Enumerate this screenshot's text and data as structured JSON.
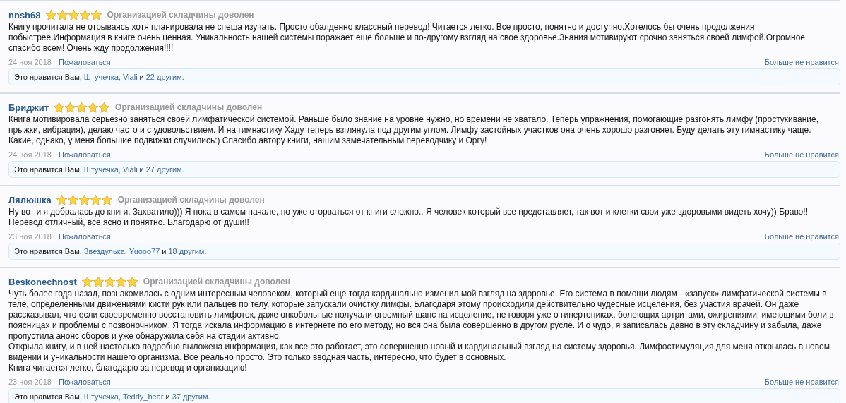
{
  "reviews": [
    {
      "author": "nnsh68",
      "stars": 5,
      "rating_text": "Организацией складчины доволен",
      "lines": [
        "Книгу прочитала не отрываясь хотя планировала не спеша изучать. Просто обалденно классный перевод! Читается легко. Все просто, понятно и доступно.Хотелось бы очень продолжения",
        "побыстрее.Информация в книге очень ценная. Уникальность нашей системы поражает еще больше и по-другому взгляд на свое здоровье.Знания мотивируют срочно заняться своей лимфой.Огромное",
        "спасибо всем! Очень жду продолжения!!!!"
      ],
      "date": "24 ноя 2018",
      "report_link": "Пожаловаться",
      "unlike_link": "Больше не нравится",
      "likes": {
        "prefix": "Это нравится Вам,",
        "users": [
          "Штучечка,",
          "Viali"
        ],
        "joiner": "и",
        "others": "22 другим."
      }
    },
    {
      "author": "Бриджит",
      "stars": 5,
      "rating_text": "Организацией складчины доволен",
      "lines": [
        "Книга мотивировала серьезно заняться своей лимфатической системой. Раньше было знание на уровне нужно, но времени не хватало. Теперь упражнения, помогающие разгонять лимфу (простукивание,",
        "прыжки, вибрация), делаю часто и с удовольствием. И на гимнастику Хаду теперь взглянула под другим углом. Лимфу застойных участков она очень хорошо разгоняет. Буду делать эту гимнастику чаще.",
        "Какие, однако, у меня большие подвижки случились:) Спасибо автору книги, нашим замечательным переводчику и Оргу!"
      ],
      "date": "24 ноя 2018",
      "report_link": "Пожаловаться",
      "unlike_link": "Больше не нравится",
      "likes": {
        "prefix": "Это нравится Вам,",
        "users": [
          "Штучечка,",
          "Viali"
        ],
        "joiner": "и",
        "others": "27 другим."
      }
    },
    {
      "author": "Лялюшка",
      "stars": 5,
      "rating_text": "Организацией складчины доволен",
      "lines": [
        "Ну вот и я добралась до книги. Захватило))) Я пока в самом начале, но уже оторваться от книги сложно.. Я человек который все представляет, так вот и клетки свои уже здоровыми видеть хочу)) Браво!!",
        "Перевод отличный, все ясно и понятно. Благодарю от души!!"
      ],
      "date": "23 ноя 2018",
      "report_link": "Пожаловаться",
      "unlike_link": "Больше не нравится",
      "likes": {
        "prefix": "Это нравится Вам,",
        "users": [
          "Звездулька,",
          "Yuooo77"
        ],
        "joiner": "и",
        "others": "18 другим."
      }
    },
    {
      "author": "Beskonechnost",
      "stars": 5,
      "rating_text": "Организацией складчины доволен",
      "lines": [
        "Чуть более года назад, познакомилась с одним интересным человеком, который еще тогда кардинально изменил мой взгляд на здоровье. Его система в помощи людям - «запуск» лимфатической системы в",
        "теле, определенными движениями кисти рук или пальцев по телу, которые запускали очистку лимфы. Благодаря этому происходили действительно чудесные исцеления, без участия врачей. Он даже",
        "рассказывал, что если своевременно восстановить лимфоток, даже онкобольные получали огромный шанс на исцеление, не говоря уже о гипертониках, болеющих артритами, ожирениями, имеющими боли в",
        "поясницах и проблемы с позвоночником. Я тогда искала информацию в интернете по его методу, но вся она была совершенно в другом русле. И о чудо, я записалась давно в эту складчину и забыла, даже",
        "пропустила анонс сборов и уже обнаружила себя на стадии активно.",
        "Открыла книгу, и в ней настолько подробно выложена информация, как все это работает, это совершенно новый и кардинальный взгляд на систему здоровья. Лимфостимуляция для меня открылась в новом",
        "видении и уникальности нашего организма. Все реально просто. Это только вводная часть, интересно, что будет в основных.",
        "Книга читается легко, благодарю за перевод и организацию!"
      ],
      "date": "23 ноя 2018",
      "report_link": "Пожаловаться",
      "unlike_link": "Больше не нравится",
      "likes": {
        "prefix": "Это нравится Вам,",
        "users": [
          "Штучечка,",
          "Teddy_bear"
        ],
        "joiner": "и",
        "others": "37 другим."
      }
    }
  ]
}
